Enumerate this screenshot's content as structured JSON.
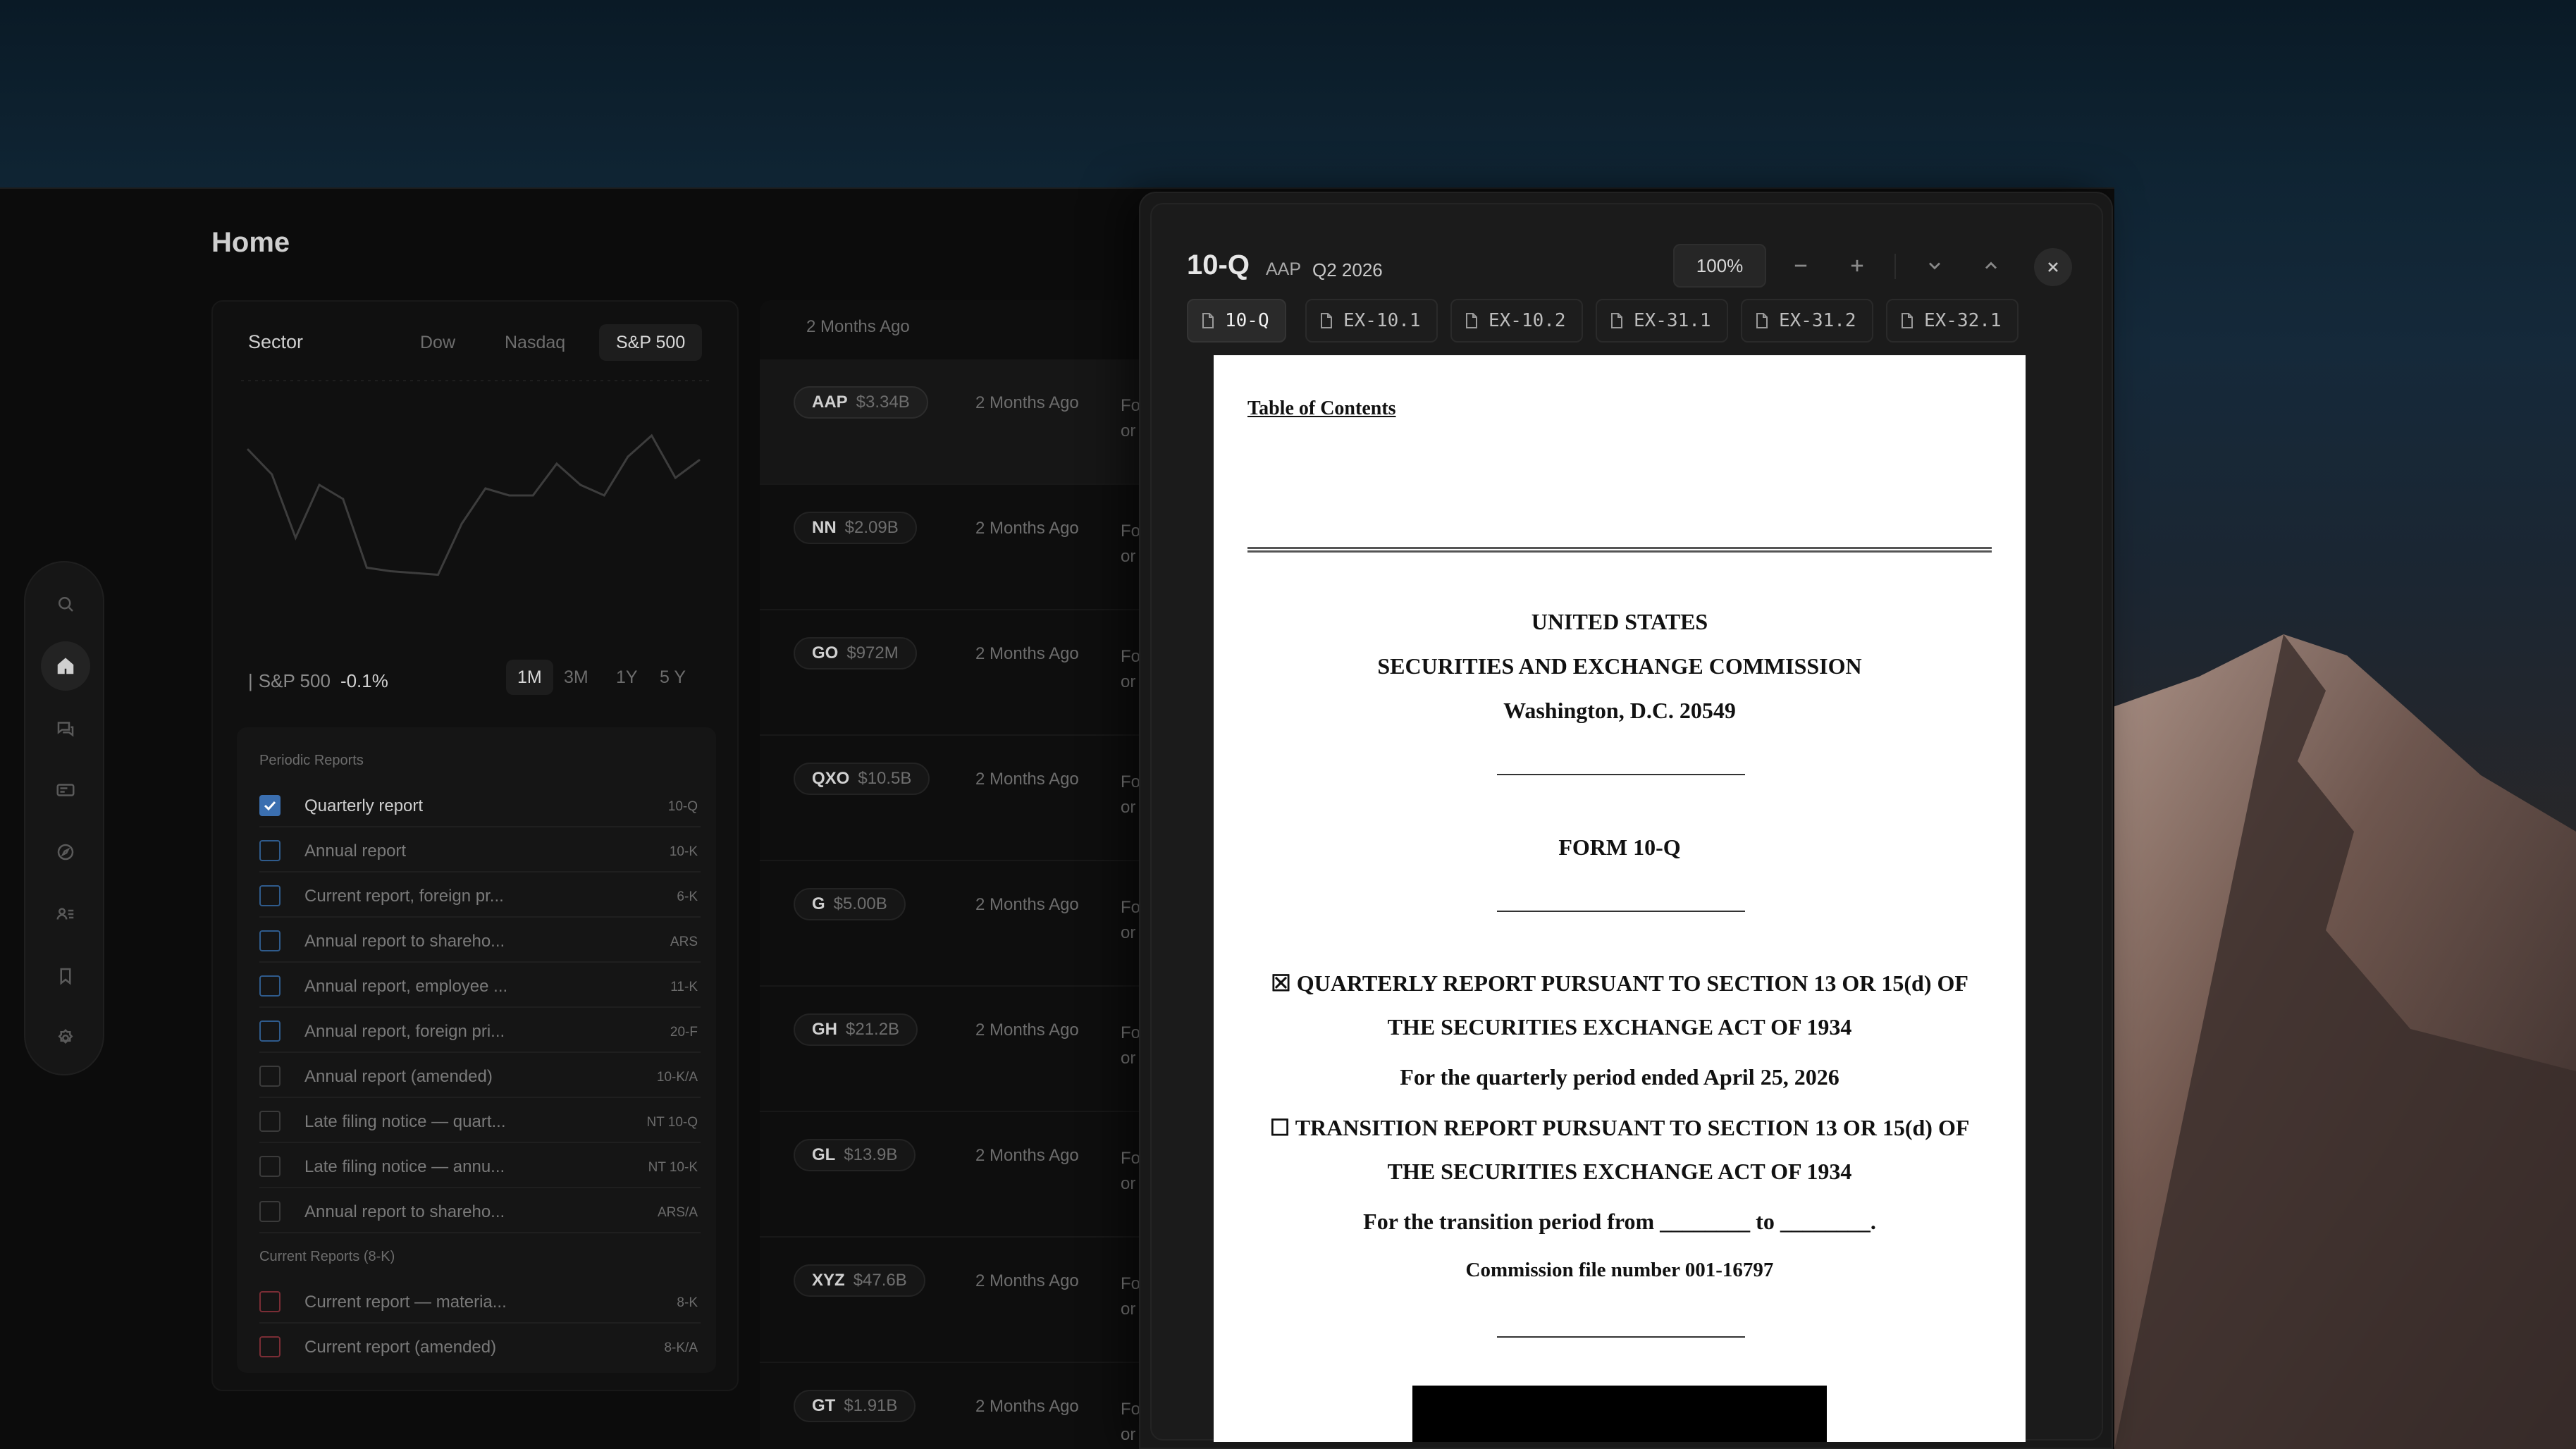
{
  "app": {
    "title": "Home"
  },
  "rail": {
    "items": [
      "search-icon",
      "home-icon",
      "chat-icon",
      "card-icon",
      "compass-icon",
      "users-icon",
      "bookmark-icon",
      "settings-icon"
    ],
    "active": "home-icon"
  },
  "sector": {
    "title": "Sector",
    "tabs": [
      "Dow",
      "Nasdaq",
      "S&P 500"
    ],
    "active_tab": "S&P 500",
    "caption_index": "S&P 500",
    "caption_change": "-0.1%",
    "ranges": [
      "1M",
      "3M",
      "1Y",
      "5 Y"
    ],
    "active_range": "1M"
  },
  "chart_data": {
    "type": "line",
    "title": "",
    "xlabel": "",
    "ylabel": "",
    "grid": false,
    "series": [
      {
        "values": [
          0.72,
          0.58,
          0.22,
          0.52,
          0.44,
          0.05,
          0.03,
          0.02,
          0.01,
          0.3,
          0.5,
          0.46,
          0.46,
          0.64,
          0.52,
          0.46,
          0.68,
          0.8,
          0.56,
          0.66
        ]
      }
    ]
  },
  "forms": {
    "groups": [
      {
        "label": "Periodic Reports",
        "items": [
          {
            "label": "Quarterly report",
            "code": "10-Q",
            "checked": true
          },
          {
            "label": "Annual report",
            "code": "10-K",
            "checked": false
          },
          {
            "label": "Current report, foreign pr...",
            "code": "6-K",
            "checked": false
          },
          {
            "label": "Annual report to shareho...",
            "code": "ARS",
            "checked": false
          },
          {
            "label": "Annual report, employee ...",
            "code": "11-K",
            "checked": false
          },
          {
            "label": "Annual report, foreign pri...",
            "code": "20-F",
            "checked": false
          },
          {
            "label": "Annual report (amended)",
            "code": "10-K/A",
            "checked": false
          },
          {
            "label": "Late filing notice — quart...",
            "code": "NT 10-Q",
            "checked": false
          },
          {
            "label": "Late filing notice — annu...",
            "code": "NT 10-K",
            "checked": false
          },
          {
            "label": "Annual report to shareho...",
            "code": "ARS/A",
            "checked": false
          }
        ]
      },
      {
        "label": "Current Reports (8-K)",
        "items": [
          {
            "label": "Current report — materia...",
            "code": "8-K",
            "checked": false
          },
          {
            "label": "Current report (amended)",
            "code": "8-K/A",
            "checked": false
          }
        ]
      }
    ]
  },
  "filings": {
    "header": "2 Months Ago",
    "rows": [
      {
        "ticker": "AAP",
        "cap": "$3.34B",
        "when": "2 Months Ago",
        "desc1": "Fo",
        "desc2": "or"
      },
      {
        "ticker": "NN",
        "cap": "$2.09B",
        "when": "2 Months Ago",
        "desc1": "Fo",
        "desc2": "or"
      },
      {
        "ticker": "GO",
        "cap": "$972M",
        "when": "2 Months Ago",
        "desc1": "Fo",
        "desc2": "or"
      },
      {
        "ticker": "QXO",
        "cap": "$10.5B",
        "when": "2 Months Ago",
        "desc1": "Fo",
        "desc2": "or"
      },
      {
        "ticker": "G",
        "cap": "$5.00B",
        "when": "2 Months Ago",
        "desc1": "Fo",
        "desc2": "or"
      },
      {
        "ticker": "GH",
        "cap": "$21.2B",
        "when": "2 Months Ago",
        "desc1": "Fo",
        "desc2": "or"
      },
      {
        "ticker": "GL",
        "cap": "$13.9B",
        "when": "2 Months Ago",
        "desc1": "Fo",
        "desc2": "or"
      },
      {
        "ticker": "XYZ",
        "cap": "$47.6B",
        "when": "2 Months Ago",
        "desc1": "Fo",
        "desc2": "or"
      },
      {
        "ticker": "GT",
        "cap": "$1.91B",
        "when": "2 Months Ago",
        "desc1": "Fo",
        "desc2": "or"
      }
    ]
  },
  "viewer": {
    "doc_type": "10-Q",
    "ticker": "AAP",
    "period": "Q2 2026",
    "zoom": "100%",
    "tabs": [
      "10-Q",
      "EX-10.1",
      "EX-10.2",
      "EX-31.1",
      "EX-31.2",
      "EX-32.1"
    ],
    "active_tab": "10-Q"
  },
  "document": {
    "toc": "Table of Contents",
    "line1": "UNITED STATES",
    "line2": "SECURITIES AND EXCHANGE COMMISSION",
    "line3": "Washington, D.C. 20549",
    "form": "FORM 10-Q",
    "quarterly_a": "☒ QUARTERLY REPORT PURSUANT TO SECTION 13 OR 15(d) OF",
    "quarterly_b": "THE SECURITIES EXCHANGE ACT OF 1934",
    "period_line": "For the quarterly period ended April 25, 2026",
    "transition_a": "☐ TRANSITION REPORT PURSUANT TO SECTION 13 OR 15(d) OF",
    "transition_b": "THE SECURITIES EXCHANGE ACT OF 1934",
    "transition_period": "For the transition period from ________ to ________.",
    "commission": "Commission file number 001-16797"
  }
}
